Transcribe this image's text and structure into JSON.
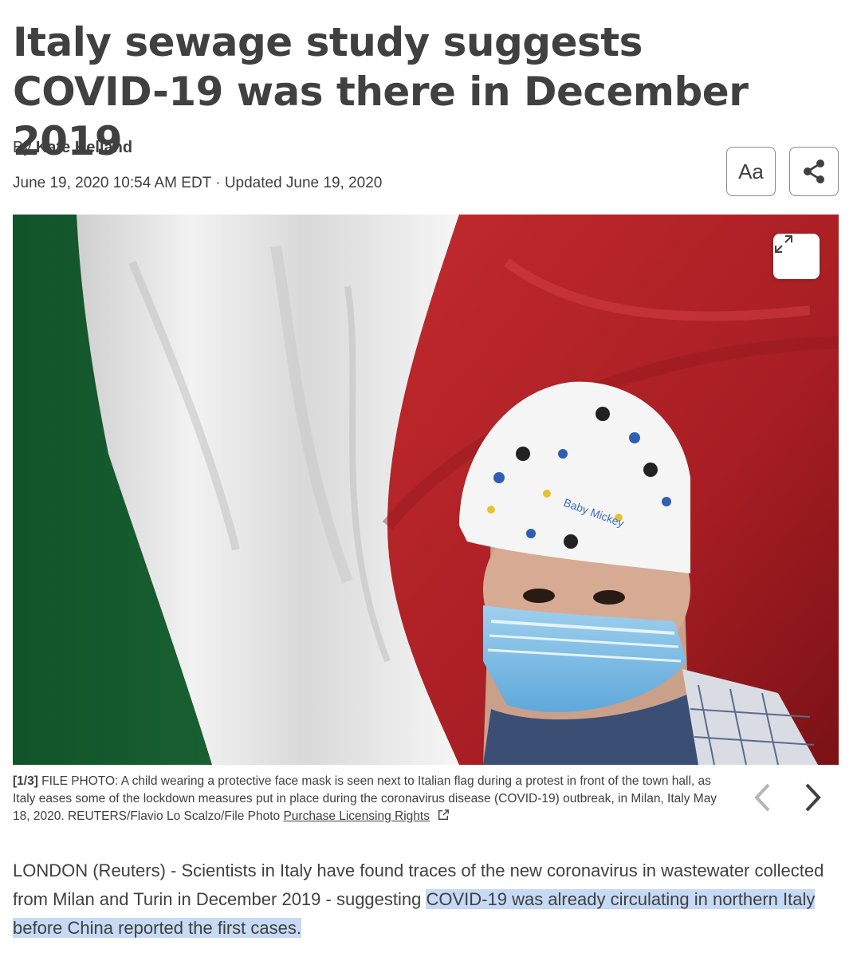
{
  "article": {
    "headline": "Italy sewage study suggests COVID-19 was there in December 2019",
    "byline_prefix": "By ",
    "author": "Kate Kelland",
    "dateline": "June 19, 2020 10:54 AM EDT · Updated June 19, 2020",
    "text_size_label": "Aa"
  },
  "photo": {
    "counter": "[1/3]",
    "caption": " FILE PHOTO: A child wearing a protective face mask is seen next to Italian flag during a protest in front of the town hall, as Italy eases some of the lockdown measures put in place during the coronavirus disease (COVID-19) outbreak, in Milan, Italy May 18, 2020. REUTERS/Flavio Lo Scalzo/File Photo ",
    "licensing_link": "Purchase Licensing Rights",
    "mask_print_text": "Baby Mickey"
  },
  "body": {
    "lede_plain": "LONDON (Reuters) - Scientists in Italy have found traces of the new coronavirus in wastewater collected from Milan and Turin in December 2019 - suggesting ",
    "lede_highlight": "COVID-19 was already circulating in northern Italy before China reported the first cases."
  },
  "colors": {
    "text": "#404040",
    "highlight": "#c6d9f5",
    "flag_green": "#1f7a3c",
    "flag_red": "#b8242a"
  },
  "icons": {
    "share": "share-icon",
    "expand": "expand-icon",
    "prev": "chevron-left-icon",
    "next": "chevron-right-icon",
    "external": "external-link-icon"
  }
}
